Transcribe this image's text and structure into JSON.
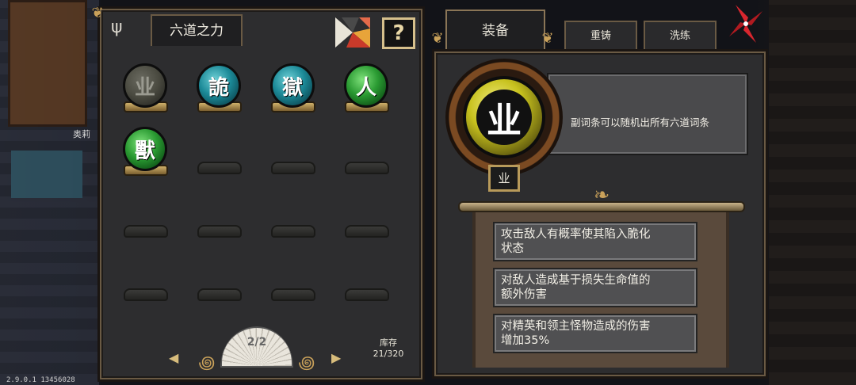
{
  "background": {
    "npc_name": "奥莉",
    "version": "2.9.0.1 13456028"
  },
  "left_panel": {
    "title": "六道之力",
    "help_label": "?",
    "orbs": [
      {
        "glyph": "业",
        "color": "dim",
        "filled": true
      },
      {
        "glyph": "詭",
        "color": "teal",
        "filled": true
      },
      {
        "glyph": "獄",
        "color": "teal",
        "filled": true
      },
      {
        "glyph": "人",
        "color": "green",
        "filled": true
      },
      {
        "glyph": "獸",
        "color": "green",
        "filled": true
      }
    ],
    "empty_slot_count": 11,
    "pager": {
      "label": "2/2",
      "prev": "◀",
      "next": "▶"
    },
    "stock": {
      "label": "库存",
      "value": "21/320"
    }
  },
  "right_panel": {
    "tabs": {
      "equip": "装备",
      "recast": "重铸",
      "wash": "洗练"
    },
    "item": {
      "glyph": "业",
      "badge": "业",
      "description": "副词条可以随机出所有六道词条"
    },
    "affixes": [
      {
        "line1": "攻击敌人有概率使其陷入脆化",
        "line2": "状态"
      },
      {
        "line1": "对敌人造成基于损失生命值的",
        "line2": "额外伤害"
      },
      {
        "line1": "对精英和领主怪物造成的伤害",
        "line2": "增加35%"
      }
    ]
  },
  "colors": {
    "gold": "#c9a15a",
    "teal_orb": "#1c8a98",
    "green_orb": "#2a9a32",
    "yellow_orb": "#c8c21e",
    "close_red": "#d8262e"
  }
}
